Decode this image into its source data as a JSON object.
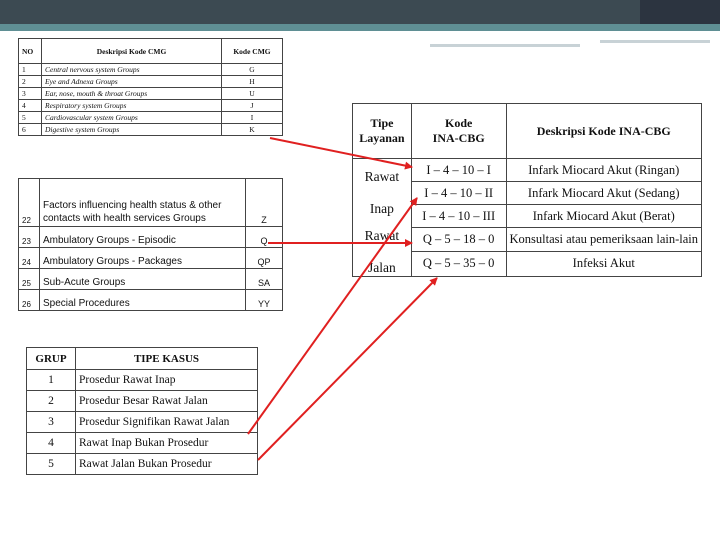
{
  "cmg_table": {
    "headers": [
      "NO",
      "Deskripsi Kode CMG",
      "Kode CMG"
    ],
    "rows": [
      {
        "no": "1",
        "desc": "Central nervous system Groups",
        "code": "G"
      },
      {
        "no": "2",
        "desc": "Eye and Adnexa Groups",
        "code": "H"
      },
      {
        "no": "3",
        "desc": "Ear, nose, mouth & throat Groups",
        "code": "U"
      },
      {
        "no": "4",
        "desc": "Respiratory system Groups",
        "code": "J"
      },
      {
        "no": "5",
        "desc": "Cardiovascular system Groups",
        "code": "I"
      },
      {
        "no": "6",
        "desc": "Digestive system Groups",
        "code": "K"
      }
    ]
  },
  "groups_table": {
    "rows": [
      {
        "no": "22",
        "desc": "Factors influencing health status & other contacts with health services Groups",
        "code": "Z"
      },
      {
        "no": "23",
        "desc": "Ambulatory Groups - Episodic",
        "code": "Q"
      },
      {
        "no": "24",
        "desc": "Ambulatory Groups - Packages",
        "code": "QP"
      },
      {
        "no": "25",
        "desc": "Sub-Acute Groups",
        "code": "SA"
      },
      {
        "no": "26",
        "desc": "Special Procedures",
        "code": "YY"
      }
    ]
  },
  "tipe_kasus_table": {
    "headers": [
      "GRUP",
      "TIPE KASUS"
    ],
    "rows": [
      {
        "grup": "1",
        "tipe": "Prosedur Rawat Inap"
      },
      {
        "grup": "2",
        "tipe": "Prosedur Besar Rawat Jalan"
      },
      {
        "grup": "3",
        "tipe": "Prosedur Signifikan Rawat Jalan"
      },
      {
        "grup": "4",
        "tipe": "Rawat Inap Bukan Prosedur"
      },
      {
        "grup": "5",
        "tipe": "Rawat Jalan Bukan Prosedur"
      }
    ]
  },
  "ina_cbg_table": {
    "headers": {
      "tipe_line1": "Tipe",
      "tipe_line2": "Layanan",
      "kode_line1": "Kode",
      "kode_line2": "INA-CBG",
      "deskripsi": "Deskripsi Kode INA-CBG"
    },
    "groups": [
      {
        "layanan_line1": "Rawat",
        "layanan_line2": "Inap"
      },
      {
        "layanan_line1": "Rawat",
        "layanan_line2": "Jalan"
      }
    ],
    "rows": [
      {
        "code": "I – 4 – 10 – I",
        "desc": "Infark Miocard Akut (Ringan)"
      },
      {
        "code": "I – 4 – 10 – II",
        "desc": "Infark Miocard Akut (Sedang)"
      },
      {
        "code": "I – 4 – 10 – III",
        "desc": "Infark Miocard Akut (Berat)"
      },
      {
        "code": "Q – 5 – 18 – 0",
        "desc": "Konsultasi atau pemeriksaan lain-lain"
      },
      {
        "code": "Q – 5 – 35 – 0",
        "desc": "Infeksi Akut"
      }
    ]
  },
  "colors": {
    "arrow": "#e02020",
    "topbar": "#3c4a52",
    "teal": "#5f8f94"
  }
}
